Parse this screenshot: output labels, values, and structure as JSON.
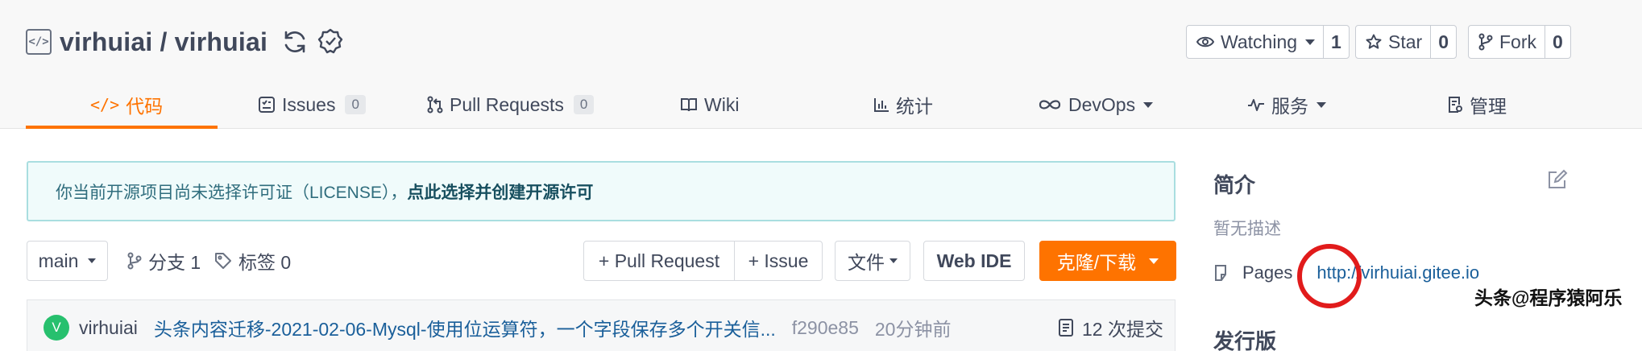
{
  "repo": {
    "owner": "virhuiai",
    "name": "virhuiai",
    "full_name": "virhuiai / virhuiai"
  },
  "actions": {
    "watch": {
      "label": "Watching",
      "count": "1"
    },
    "star": {
      "label": "Star",
      "count": "0"
    },
    "fork": {
      "label": "Fork",
      "count": "0"
    }
  },
  "tabs": [
    {
      "label": "代码"
    },
    {
      "label": "Issues",
      "badge": "0"
    },
    {
      "label": "Pull Requests",
      "badge": "0"
    },
    {
      "label": "Wiki"
    },
    {
      "label": "统计"
    },
    {
      "label": "DevOps"
    },
    {
      "label": "服务"
    },
    {
      "label": "管理"
    }
  ],
  "notice": {
    "text": "你当前开源项目尚未选择许可证（LICENSE），",
    "link": "点此选择并创建开源许可"
  },
  "toolbar": {
    "branch": "main",
    "branches_label": "分支 1",
    "tags_label": "标签 0",
    "pull_request": "+ Pull Request",
    "issue": "+ Issue",
    "files": "文件",
    "web_ide": "Web IDE",
    "clone": "克隆/下载"
  },
  "commit": {
    "avatar_letter": "V",
    "author": "virhuiai",
    "message": "头条内容迁移-2021-02-06-Mysql-使用位运算符，一个字段保存多个开关信...",
    "hash": "f290e85",
    "time": "20分钟前",
    "count": "12 次提交"
  },
  "sidebar": {
    "intro_title": "简介",
    "description": "暂无描述",
    "pages_label": "Pages",
    "pages_url": "http://virhuiai.gitee.io",
    "release_title": "发行版"
  },
  "watermark": "头条@程序猿阿乐",
  "colors": {
    "accent": "#fe7300",
    "link": "#1a5f9a",
    "highlight": "#e11b1b"
  }
}
